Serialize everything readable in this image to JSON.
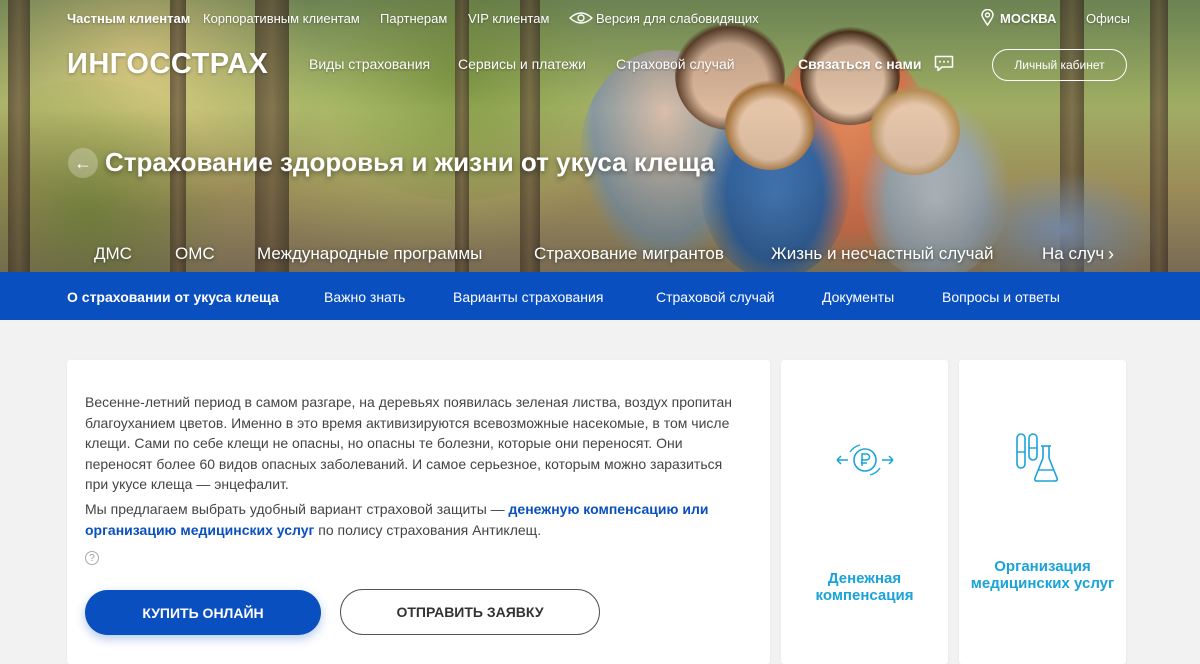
{
  "topbar": {
    "private_clients": "Частным клиентам",
    "corporate_clients": "Корпоративным клиентам",
    "partners": "Партнерам",
    "vip_clients": "VIP клиентам",
    "accessibility": "Версия для слабовидящих",
    "city": "МОСКВА",
    "offices": "Офисы"
  },
  "header": {
    "logo": "ИНГОССТРАХ",
    "nav": [
      "Виды страхования",
      "Сервисы и платежи",
      "Страховой случай"
    ],
    "contact": "Связаться с нами",
    "cabinet": "Личный кабинет"
  },
  "hero": {
    "back": "←",
    "title": "Страхование здоровья и жизни от укуса клеща",
    "categories": [
      "ДМС",
      "ОМС",
      "Международные программы",
      "Страхование мигрантов",
      "Жизнь и несчастный случай",
      "На случ"
    ],
    "next": "›"
  },
  "subnav": {
    "items": [
      "О страховании от укуса клеща",
      "Важно знать",
      "Варианты страхования",
      "Страховой случай",
      "Документы",
      "Вопросы и ответы"
    ]
  },
  "main": {
    "paragraph1": "Весенне-летний период в самом разгаре, на деревьях появилась зеленая листва, воздух пропитан благоуханием цветов. Именно в это время активизируются всевозможные насекомые, в том числе клещи. Сами по себе клещи не опасны, но опасны те болезни, которые они переносят. Они переносят более 60 видов опасных заболеваний. И самое серьезное, которым можно заразиться при укусе клеща — энцефалит.",
    "paragraph2_prefix": "Мы предлагаем выбрать удобный вариант страховой защиты — ",
    "paragraph2_link": "денежную компенсацию или организацию медицинских услуг",
    "paragraph2_suffix": " по полису страхования Антиклещ.",
    "help": "?",
    "buy_button": "КУПИТЬ ОНЛАЙН",
    "request_button": "ОТПРАВИТЬ ЗАЯВКУ"
  },
  "options": {
    "money": "Денежная компенсация",
    "medical": "Организация медицинских услуг"
  },
  "colors": {
    "brand_blue": "#0a4fbf",
    "accent_cyan": "#1aa3d9"
  }
}
